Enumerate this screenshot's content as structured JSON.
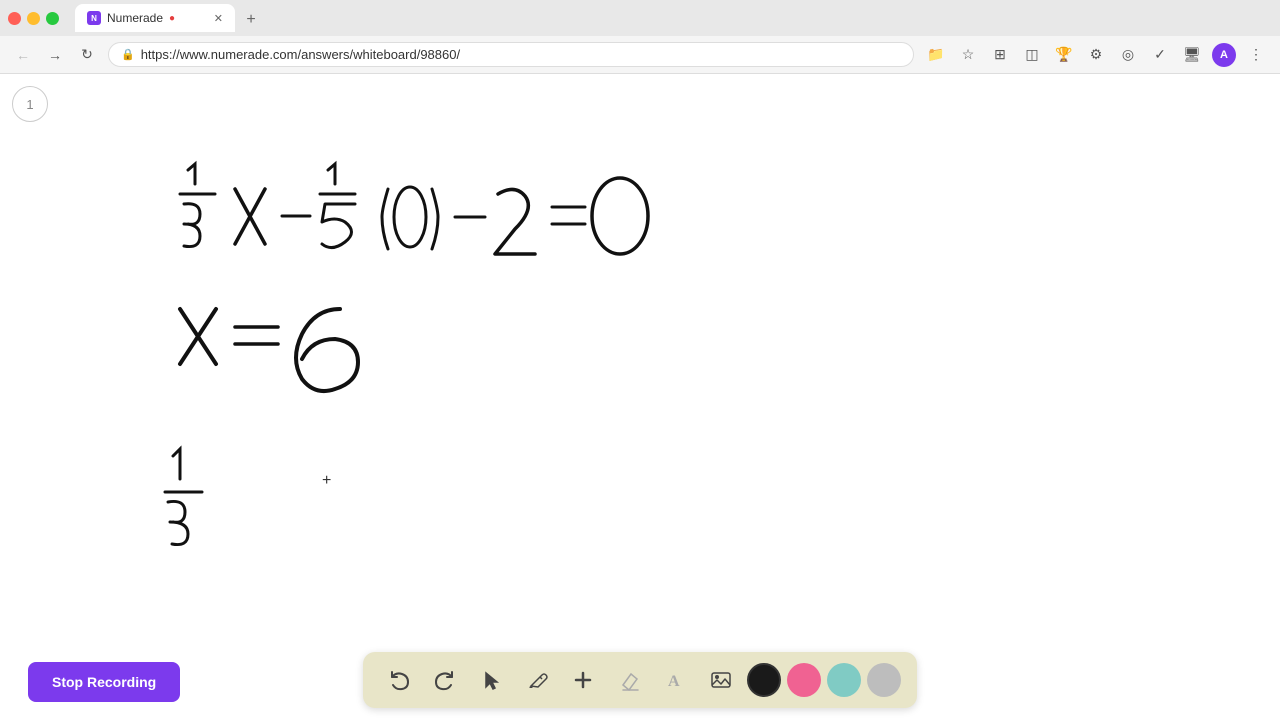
{
  "browser": {
    "tab_title": "Numerade",
    "tab_favicon": "●",
    "url": "https://www.numerade.com/answers/whiteboard/98860/",
    "new_tab_label": "+",
    "nav": {
      "back_label": "←",
      "forward_label": "→",
      "reload_label": "↺"
    }
  },
  "page": {
    "number": "1"
  },
  "cursor": {
    "symbol": "+"
  },
  "toolbar": {
    "undo_label": "↺",
    "redo_label": "↻",
    "select_label": "▶",
    "pen_label": "✏",
    "add_label": "+",
    "eraser_label": "/",
    "text_label": "A",
    "image_label": "🖼",
    "colors": {
      "black": "#1a1a1a",
      "pink": "#f48fb1",
      "green": "#80cbc4",
      "gray": "#bdbdbd"
    }
  },
  "stop_recording": {
    "label": "Stop Recording",
    "bg_color": "#7c3aed"
  }
}
